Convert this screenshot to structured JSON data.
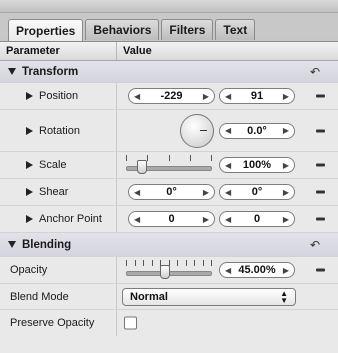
{
  "tabs": [
    "Properties",
    "Behaviors",
    "Filters",
    "Text"
  ],
  "columns": {
    "parameter": "Parameter",
    "value": "Value"
  },
  "transform": {
    "title": "Transform",
    "reset_icon": "↶",
    "position": {
      "label": "Position",
      "x": "-229",
      "y": "91"
    },
    "rotation": {
      "label": "Rotation",
      "value": "0.0°"
    },
    "scale": {
      "label": "Scale",
      "value": "100%",
      "slider_fraction": 0.14
    },
    "shear": {
      "label": "Shear",
      "x": "0°",
      "y": "0°"
    },
    "anchor": {
      "label": "Anchor Point",
      "x": "0",
      "y": "0"
    }
  },
  "blending": {
    "title": "Blending",
    "reset_icon": "↶",
    "opacity": {
      "label": "Opacity",
      "value": "45.00%",
      "slider_fraction": 0.45
    },
    "blend_mode": {
      "label": "Blend Mode",
      "value": "Normal"
    },
    "preserve_opacity": {
      "label": "Preserve Opacity",
      "checked": false
    }
  },
  "glyphs": {
    "left": "◀",
    "right": "▶",
    "up": "▲",
    "down": "▼"
  }
}
